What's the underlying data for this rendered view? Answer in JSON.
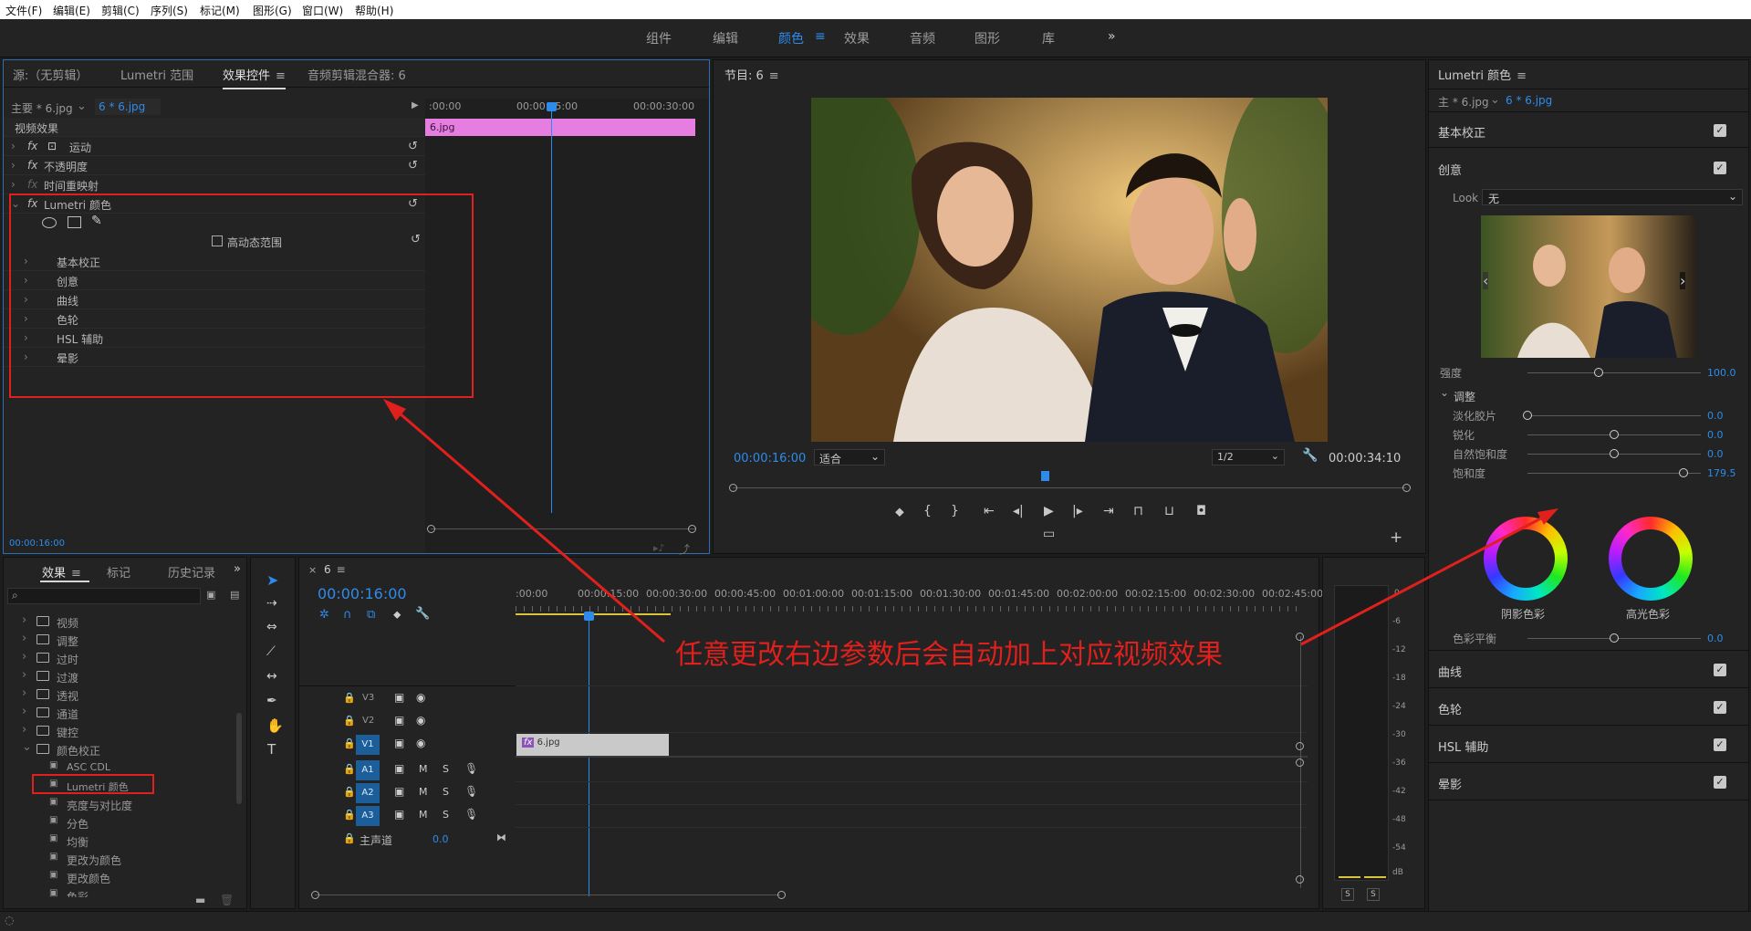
{
  "menu": [
    "文件(F)",
    "编辑(E)",
    "剪辑(C)",
    "序列(S)",
    "标记(M)",
    "图形(G)",
    "窗口(W)",
    "帮助(H)"
  ],
  "workspaces": [
    "组件",
    "编辑",
    "颜色",
    "效果",
    "音频",
    "图形",
    "库"
  ],
  "workspace_active": "颜色",
  "source_panel": {
    "tabs": [
      "源:（无剪辑）",
      "Lumetri 范围",
      "效果控件",
      "音频剪辑混合器: 6"
    ],
    "active_tab": "效果控件",
    "master_label": "主要 * 6.jpg",
    "clip_label": "6 * 6.jpg",
    "ruler": [
      ":00:00",
      "00:00:15:00",
      "00:00:30:00"
    ],
    "clip_bar": "6.jpg",
    "section": "视频效果",
    "effects": [
      "运动",
      "不透明度",
      "时间重映射",
      "Lumetri 颜色"
    ],
    "hdr": "高动态范围",
    "lumetri_items": [
      "基本校正",
      "创意",
      "曲线",
      "色轮",
      "HSL 辅助",
      "晕影"
    ],
    "timecode": "00:00:16:00"
  },
  "program": {
    "title": "节目: 6",
    "timecode": "00:00:16:00",
    "fit": "适合",
    "resolution": "1/2",
    "duration": "00:00:34:10"
  },
  "lumetri": {
    "title": "Lumetri 颜色",
    "master": "主 * 6.jpg",
    "clip": "6 * 6.jpg",
    "basic": "基本校正",
    "creative": "创意",
    "look_label": "Look",
    "look_value": "无",
    "intensity": {
      "label": "强度",
      "value": "100.0",
      "level": 0.41
    },
    "adjust": "调整",
    "sliders": [
      {
        "label": "淡化胶片",
        "value": "0.0",
        "level": 0.0
      },
      {
        "label": "锐化",
        "value": "0.0",
        "level": 0.5
      },
      {
        "label": "自然饱和度",
        "value": "0.0",
        "level": 0.5
      },
      {
        "label": "饱和度",
        "value": "179.5",
        "level": 0.9
      }
    ],
    "shadow": "阴影色彩",
    "highlight": "高光色彩",
    "balance": {
      "label": "色彩平衡",
      "value": "0.0",
      "level": 0.5
    },
    "sections": [
      "曲线",
      "色轮",
      "HSL 辅助",
      "晕影"
    ]
  },
  "effects_panel": {
    "tabs": [
      "效果",
      "标记",
      "历史记录"
    ],
    "active_tab": "效果",
    "folders": [
      "视频",
      "调整",
      "过时",
      "过渡",
      "透视",
      "通道",
      "键控",
      "颜色校正"
    ],
    "items": [
      "ASC CDL",
      "Lumetri 颜色",
      "亮度与对比度",
      "分色",
      "均衡",
      "更改为颜色",
      "更改颜色",
      "色彩"
    ]
  },
  "timeline": {
    "seq": "6",
    "timecode": "00:00:16:00",
    "ruler": [
      ":00:00",
      "00:00:15:00",
      "00:00:30:00",
      "00:00:45:00",
      "00:01:00:00",
      "00:01:15:00",
      "00:01:30:00",
      "00:01:45:00",
      "00:02:00:00",
      "00:02:15:00",
      "00:02:30:00",
      "00:02:45:00"
    ],
    "tracks": [
      "V3",
      "V2",
      "V1",
      "A1",
      "A2",
      "A3"
    ],
    "master": "主声道",
    "master_val": "0.0",
    "clip": "6.jpg"
  },
  "meter": [
    "0",
    "-6",
    "-12",
    "-18",
    "-24",
    "-30",
    "-36",
    "-42",
    "-48",
    "-54",
    "dB"
  ],
  "annotation": "任意更改右边参数后会自动加上对应视频效果",
  "colors": {
    "accent": "#2d8ceb",
    "annotation": "#e0201c",
    "clip_pink": "#e57ee0"
  }
}
